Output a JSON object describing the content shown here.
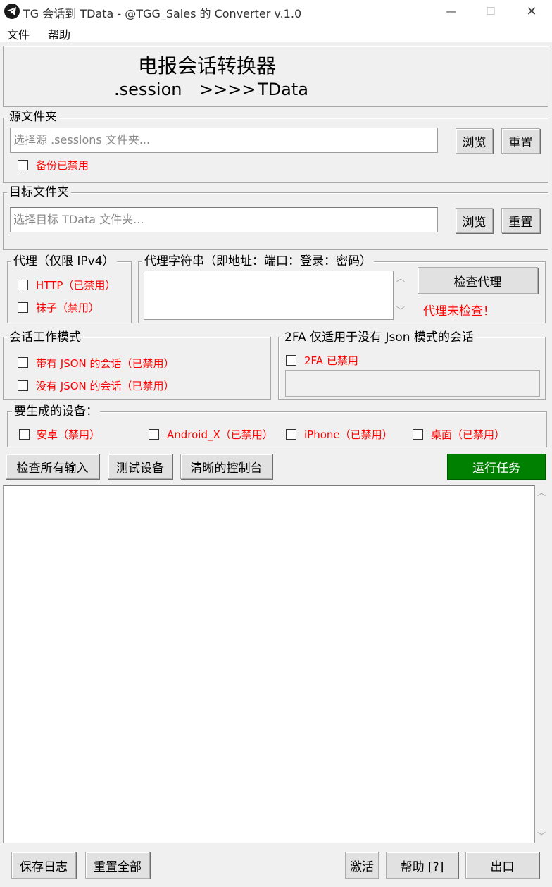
{
  "window": {
    "title": "TG 会话到 TData - @TGG_Sales 的 Converter v.1.0",
    "minimize_glyph": "—",
    "maximize_glyph": "☐",
    "close_glyph": "✕"
  },
  "menu": [
    "文件",
    "帮助"
  ],
  "header": {
    "title": "电报会话转换器",
    "subtitle_left": ".session",
    "subtitle_arrow": ">>>>",
    "subtitle_right": "TData"
  },
  "source": {
    "label": "源文件夹",
    "placeholder": "选择源 .sessions 文件夹...",
    "browse": "浏览",
    "reset": "重置",
    "backup_label": "备份已禁用"
  },
  "target": {
    "label": "目标文件夹",
    "placeholder": "选择目标 TData 文件夹...",
    "browse": "浏览",
    "reset": "重置"
  },
  "proxy": {
    "label": "代理（仅限 IPv4）",
    "http": "HTTP（已禁用）",
    "socks": "袜子（禁用）",
    "string_label": "代理字符串（即地址：端口：登录：密码）",
    "check_button": "检查代理",
    "status": "代理未检查！"
  },
  "session_mode": {
    "label": "会话工作模式",
    "with_json": "带有 JSON 的会话（已禁用）",
    "without_json": "没有 JSON 的会话（已禁用）"
  },
  "twofa": {
    "label": "2FA 仅适用于没有 Json 模式的会话",
    "checkbox": "2FA 已禁用"
  },
  "devices": {
    "label": "要生成的设备：",
    "items": [
      "安卓（禁用）",
      "Android_X（已禁用）",
      "iPhone（已禁用）",
      "桌面（已禁用）"
    ]
  },
  "actions": {
    "check_inputs": "检查所有输入",
    "test_devices": "测试设备",
    "clear_console": "清晰的控制台",
    "run_task": "运行任务"
  },
  "footer": {
    "save_log": "保存日志",
    "reset_all": "重置全部",
    "activate": "激活",
    "help": "帮助 [?]",
    "exit": "出口"
  },
  "colors": {
    "accent_green": "#008000",
    "disabled_red": "#ff0000",
    "window_bg": "#f0f0f0"
  }
}
